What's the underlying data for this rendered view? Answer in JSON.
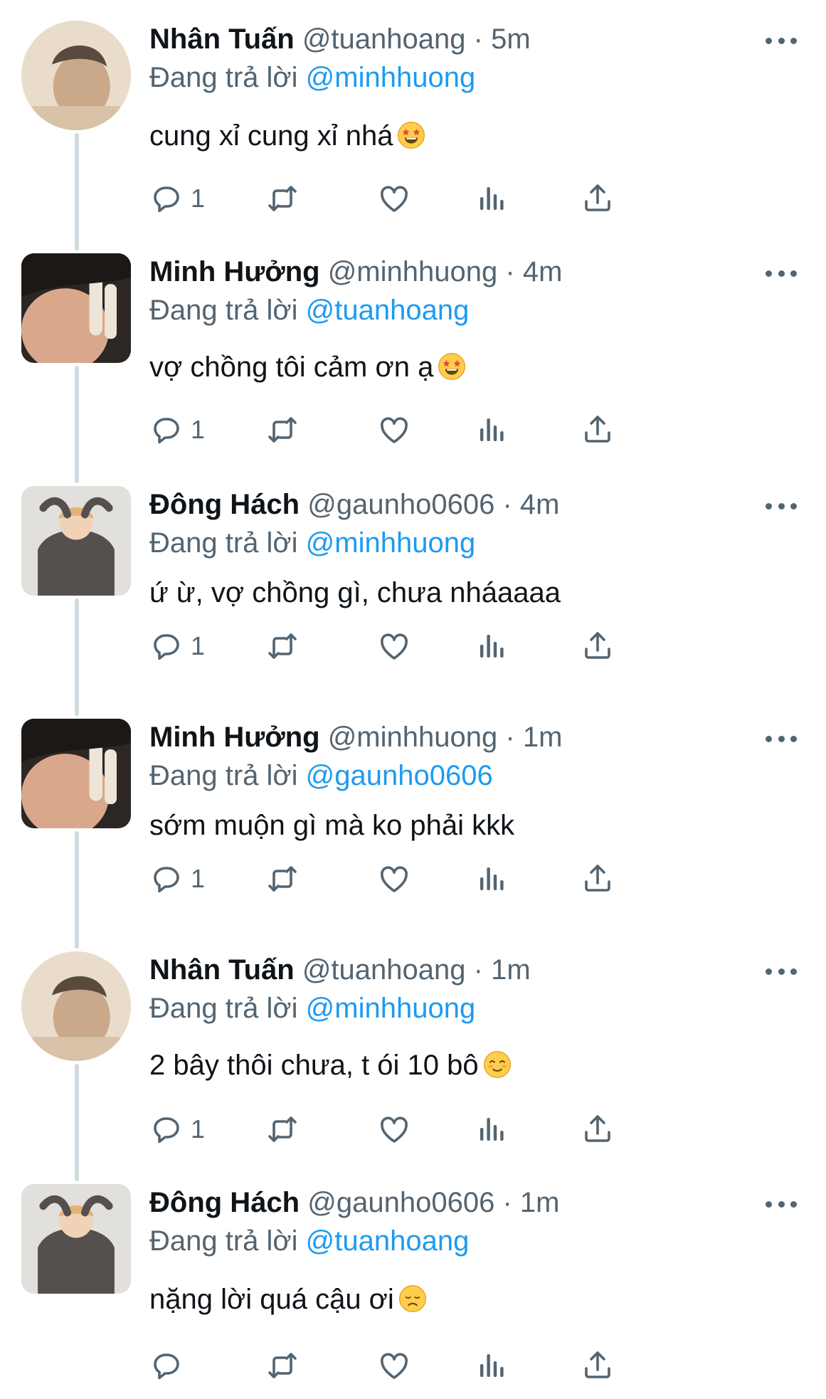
{
  "theme": {
    "accent": "#1d9bf0",
    "secondary_text": "#536471",
    "primary_text": "#0f1419",
    "thread_line": "#cfd9de"
  },
  "tweets": [
    {
      "name": "Nhân Tuấn",
      "handle": "@tuanhoang",
      "separator": "·",
      "time": "5m",
      "reply_prefix": "Đang trả lời",
      "reply_to": "@minhhuong",
      "text": "cung xỉ cung xỉ nhá",
      "emoji": "star-struck-emoji",
      "reply_count": "1",
      "avatar": "avatar-round"
    },
    {
      "name": "Minh Hưởng",
      "handle": "@minhhuong",
      "separator": "·",
      "time": "4m",
      "reply_prefix": "Đang trả lời",
      "reply_to": "@tuanhoang",
      "text": "vợ chồng tôi cảm ơn ạ",
      "emoji": "star-struck-emoji",
      "reply_count": "1",
      "avatar": "avatar-square"
    },
    {
      "name": "Đông Hách",
      "handle": "@gaunho0606",
      "separator": "·",
      "time": "4m",
      "reply_prefix": "Đang trả lời",
      "reply_to": "@minhhuong",
      "text": "ứ ừ, vợ chồng gì, chưa nháaaaa",
      "emoji": "",
      "reply_count": "1",
      "avatar": "avatar-square"
    },
    {
      "name": "Minh Hưởng",
      "handle": "@minhhuong",
      "separator": "·",
      "time": "1m",
      "reply_prefix": "Đang trả lời",
      "reply_to": "@gaunho0606",
      "text": "sớm muộn gì mà ko phải kkk",
      "emoji": "",
      "reply_count": "1",
      "avatar": "avatar-square"
    },
    {
      "name": "Nhân Tuấn",
      "handle": "@tuanhoang",
      "separator": "·",
      "time": "1m",
      "reply_prefix": "Đang trả lời",
      "reply_to": "@minhhuong",
      "text": "2 bây thôi chưa, t ói 10 bô",
      "emoji": "smiling-blush-emoji",
      "reply_count": "1",
      "avatar": "avatar-round"
    },
    {
      "name": "Đông Hách",
      "handle": "@gaunho0606",
      "separator": "·",
      "time": "1m",
      "reply_prefix": "Đang trả lời",
      "reply_to": "@tuanhoang",
      "text": "nặng lời quá cậu ơi",
      "emoji": "disappointed-emoji",
      "reply_count": "",
      "avatar": "avatar-square"
    }
  ],
  "icons": [
    "reply-icon",
    "retweet-icon",
    "like-icon",
    "analytics-icon",
    "share-icon",
    "more-icon"
  ]
}
